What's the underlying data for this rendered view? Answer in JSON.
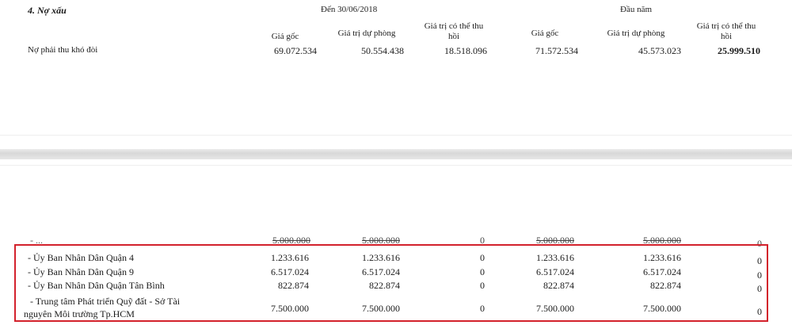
{
  "section": {
    "title": "4. Nợ xấu",
    "group_current": "Đến 30/06/2018",
    "group_opening": "Đầu năm",
    "col_headers": {
      "cur_cost": "Giá gốc",
      "cur_provision": "Giá trị dự phòng",
      "cur_recoverable_l1": "Giá trị có thể thu",
      "cur_recoverable_l2": "hồi",
      "open_cost": "Giá gốc",
      "open_provision": "Giá trị dự phòng",
      "open_recoverable_l1": "Giá trị có thể thu",
      "open_recoverable_l2": "hồi"
    },
    "row": {
      "label": "Nợ phải thu khó đòi",
      "cur_cost": "69.072.534",
      "cur_provision": "50.554.438",
      "cur_recoverable": "18.518.096",
      "open_cost": "71.572.534",
      "open_provision": "45.573.023",
      "open_recoverable": "25.999.510"
    }
  },
  "detail": {
    "partial_row": {
      "label": "- ...",
      "v1": "5.000.000",
      "v2": "5.000.000",
      "v3": "0",
      "v4": "5.000.000",
      "v5": "5.000.000",
      "v6": "0"
    },
    "rows": [
      {
        "label": "- Ủy Ban Nhân Dân Quận 4",
        "v1": "1.233.616",
        "v2": "1.233.616",
        "v3": "0",
        "v4": "1.233.616",
        "v5": "1.233.616",
        "v6": "0"
      },
      {
        "label": "- Ủy Ban Nhân Dân Quận 9",
        "v1": "6.517.024",
        "v2": "6.517.024",
        "v3": "0",
        "v4": "6.517.024",
        "v5": "6.517.024",
        "v6": "0"
      },
      {
        "label": "- Ủy Ban Nhân Dân Quận Tân Bình",
        "v1": "822.874",
        "v2": "822.874",
        "v3": "0",
        "v4": "822.874",
        "v5": "822.874",
        "v6": "0"
      },
      {
        "label": "- Trung tâm Phát triển Quỹ đất - Sở Tài",
        "label2": "nguyên Môi trường Tp.HCM",
        "v1": "7.500.000",
        "v2": "7.500.000",
        "v3": "0",
        "v4": "7.500.000",
        "v5": "7.500.000",
        "v6": "0"
      }
    ]
  },
  "colors": {
    "highlight_border": "#d3222c",
    "divider": "#dcdcdc"
  }
}
